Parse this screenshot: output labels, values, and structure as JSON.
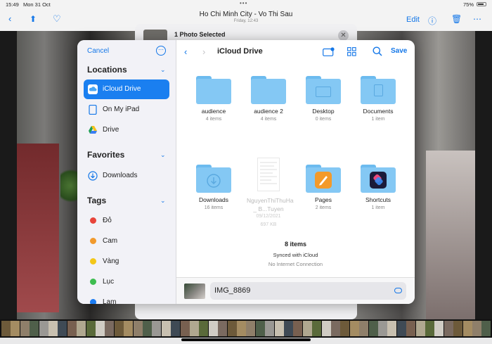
{
  "status_bar": {
    "time": "15:49",
    "date": "Mon 31 Oct",
    "dots": "•••",
    "battery": "75%"
  },
  "photo_nav": {
    "title": "Ho Chi Minh City - Vo Thi Sau",
    "subtitle": "Friday, 12:43",
    "edit": "Edit"
  },
  "share_sheet": {
    "title": "1 Photo Selected"
  },
  "sidebar": {
    "cancel": "Cancel",
    "locations_header": "Locations",
    "locations": [
      {
        "label": "iCloud Drive",
        "icon": "icloud-icon",
        "selected": true
      },
      {
        "label": "On My iPad",
        "icon": "ipad-icon",
        "selected": false
      },
      {
        "label": "Drive",
        "icon": "google-drive-icon",
        "selected": false
      }
    ],
    "favorites_header": "Favorites",
    "favorites": [
      {
        "label": "Downloads",
        "icon": "download-circle-icon"
      }
    ],
    "tags_header": "Tags",
    "tags": [
      {
        "label": "Đỏ",
        "color": "#e8443a"
      },
      {
        "label": "Cam",
        "color": "#f19a2d"
      },
      {
        "label": "Vàng",
        "color": "#f3c719"
      },
      {
        "label": "Lục",
        "color": "#3dbd4f"
      },
      {
        "label": "Lam",
        "color": "#1b7cf2"
      }
    ]
  },
  "toolbar": {
    "breadcrumb": "iCloud Drive",
    "save": "Save"
  },
  "files": [
    {
      "name": "audience",
      "meta": "4 items",
      "kind": "folder"
    },
    {
      "name": "audience 2",
      "meta": "4 items",
      "kind": "folder"
    },
    {
      "name": "Desktop",
      "meta": "0 items",
      "kind": "folder-desktop"
    },
    {
      "name": "Documents",
      "meta": "1 item",
      "kind": "folder-documents"
    },
    {
      "name": "Downloads",
      "meta": "16 items",
      "kind": "folder-downloads"
    },
    {
      "name": "NguyenThiThuHa _ B...Tuyen",
      "meta": "09/12/2021",
      "meta2": "697 KB",
      "kind": "document"
    },
    {
      "name": "Pages",
      "meta": "2 items",
      "kind": "folder-pages"
    },
    {
      "name": "Shortcuts",
      "meta": "1 item",
      "kind": "folder-shortcuts"
    }
  ],
  "folder_status": {
    "count": "8 items",
    "sync": "Synced with iCloud",
    "connection": "No Internet Connection"
  },
  "save_bar": {
    "filename": "IMG_8869"
  }
}
